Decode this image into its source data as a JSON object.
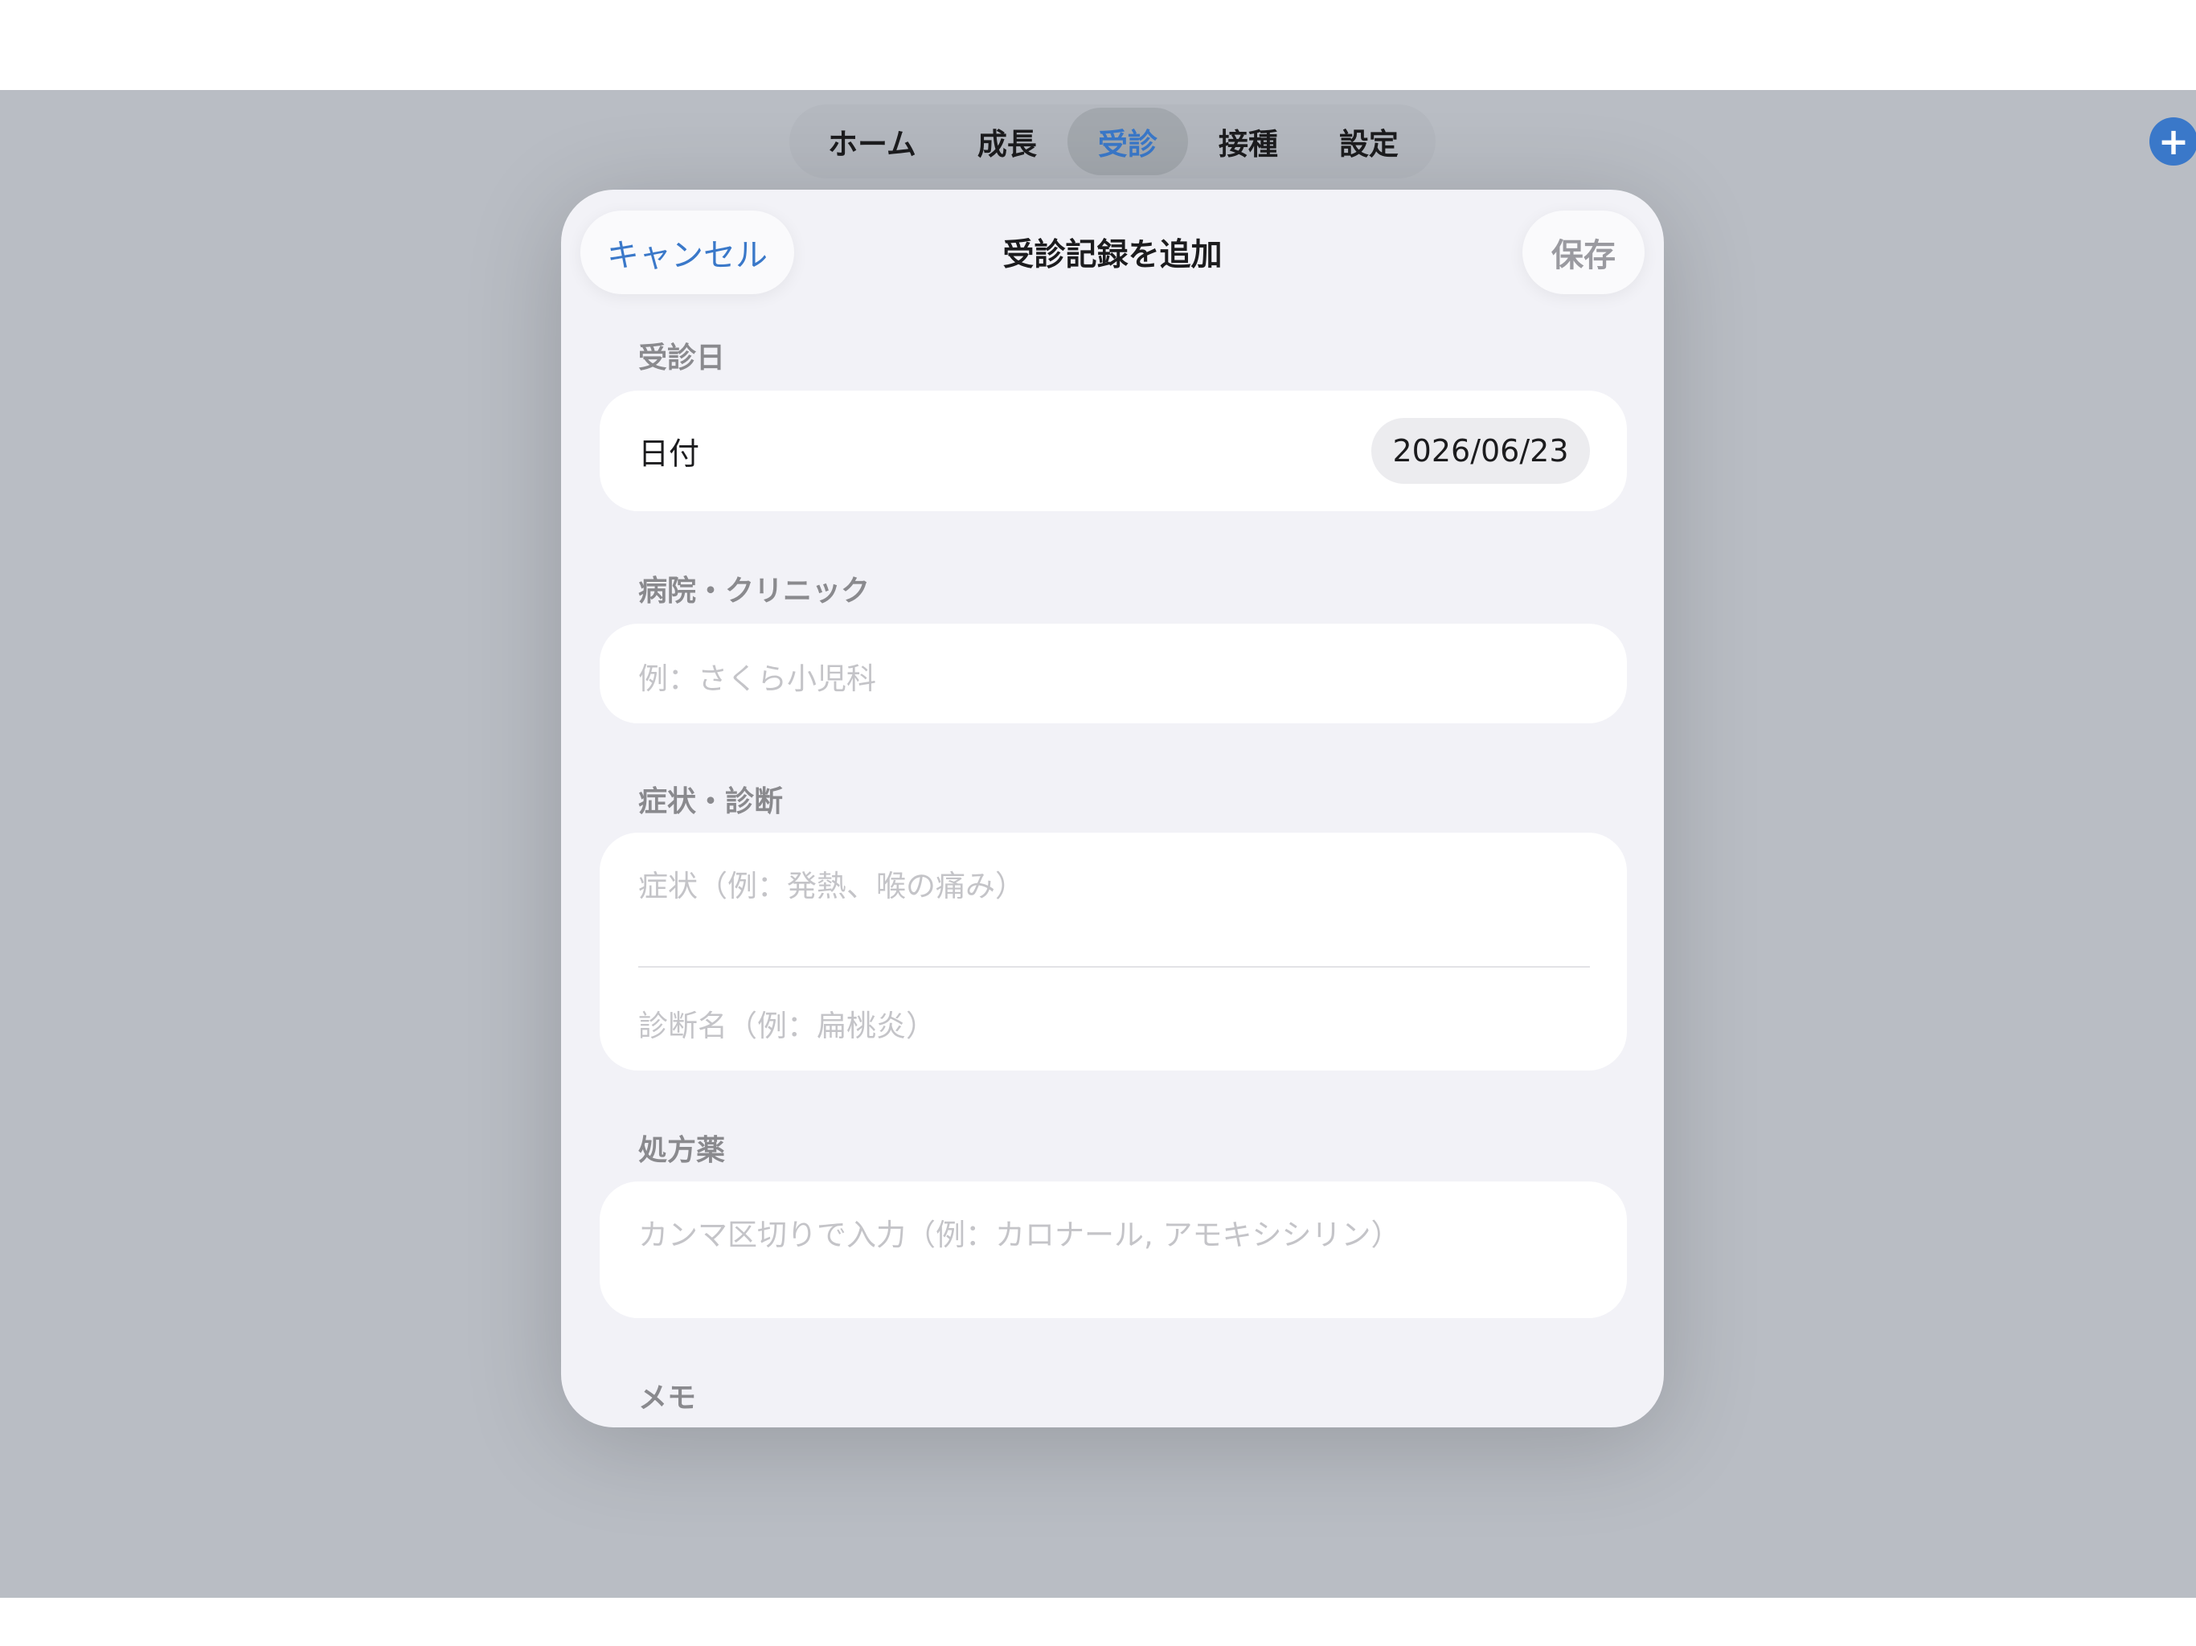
{
  "tabs": [
    {
      "label": "ホーム"
    },
    {
      "label": "成長"
    },
    {
      "label": "受診",
      "active": true
    },
    {
      "label": "接種"
    },
    {
      "label": "設定"
    }
  ],
  "toolbar": {
    "add_icon": "plus-icon",
    "add_glyph": "+"
  },
  "sheet": {
    "title": "受診記録を追加",
    "cancel_label": "キャンセル",
    "save_label": "保存"
  },
  "visit_date": {
    "section_label": "受診日",
    "field_label": "日付",
    "value": "2026/06/23"
  },
  "hospital": {
    "section_label": "病院・クリニック",
    "placeholder": "例：さくら小児科"
  },
  "symptoms": {
    "section_label": "症状・診断",
    "symptom_placeholder": "症状（例：発熱、喉の痛み）",
    "diagnosis_placeholder": "診断名（例：扁桃炎）"
  },
  "prescription": {
    "section_label": "処方薬",
    "placeholder": "カンマ区切りで入力（例：カロナール, アモキシシリン）"
  },
  "memo": {
    "section_label": "メモ"
  },
  "colors": {
    "accent": "#3a78c9",
    "sheet_background": "#f2f2f7",
    "overlay": "#b9bdc4"
  }
}
